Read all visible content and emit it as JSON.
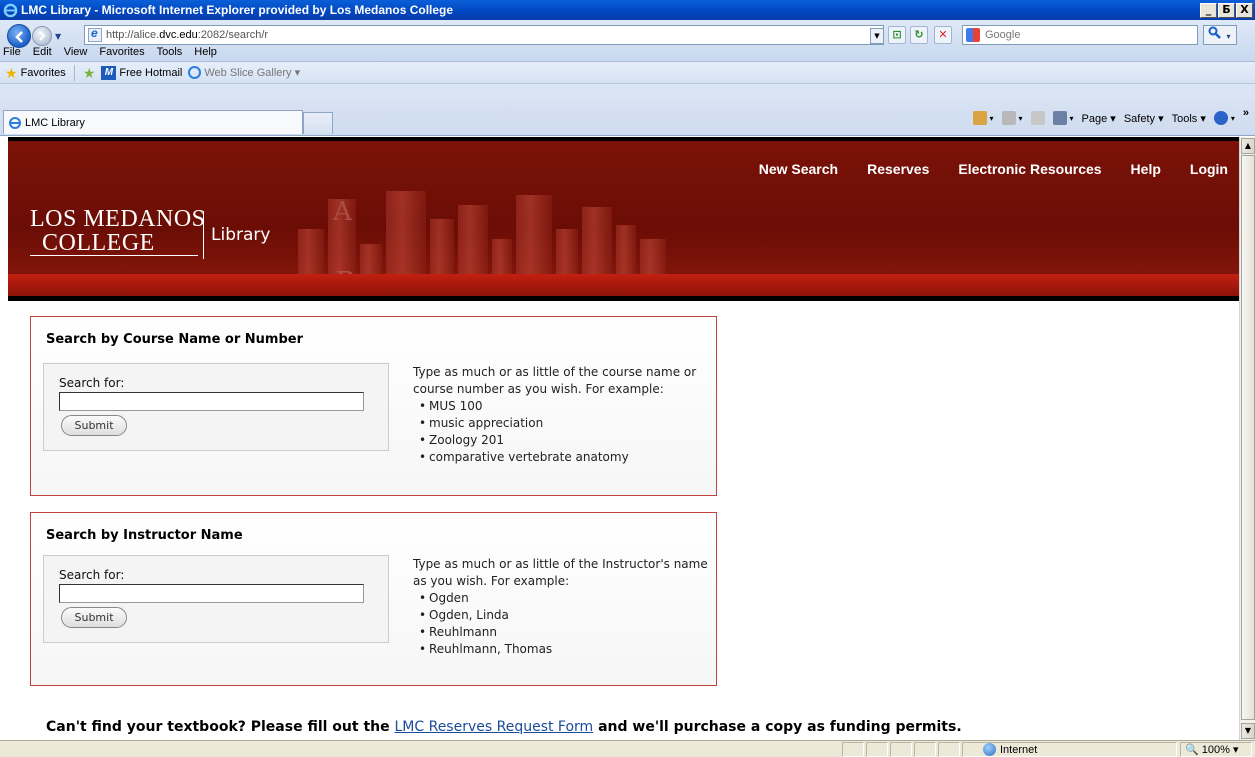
{
  "window": {
    "title": "LMC Library - Microsoft Internet Explorer provided by Los Medanos College",
    "min": "_",
    "max": "Б",
    "close": "X"
  },
  "address": {
    "url_prefix": "http://alice.",
    "url_domain": "dvc.edu",
    "url_suffix": ":2082/search/r",
    "search_placeholder": "Google"
  },
  "menu": [
    "File",
    "Edit",
    "View",
    "Favorites",
    "Tools",
    "Help"
  ],
  "favorites": {
    "label": "Favorites",
    "items": [
      "Free Hotmail",
      "Web Slice Gallery ▾"
    ]
  },
  "tab": {
    "title": "LMC Library"
  },
  "commandbar": {
    "page": "Page ▾",
    "safety": "Safety ▾",
    "tools": "Tools ▾",
    "more": "»"
  },
  "site": {
    "logo_line1": "LOS MEDANOS",
    "logo_line2": "COLLEGE",
    "logo_library": "Library",
    "nav": [
      "New Search",
      "Reserves",
      "Electronic Resources",
      "Help",
      "Login"
    ]
  },
  "course_search": {
    "heading": "Search by Course Name or Number",
    "label": "Search for:",
    "value": "",
    "submit": "Submit",
    "help_text": "Type as much or as little of the course name or course number as you wish. For example:",
    "examples": [
      "MUS 100",
      "music appreciation",
      "Zoology 201",
      "comparative vertebrate anatomy"
    ]
  },
  "instructor_search": {
    "heading": "Search by Instructor Name",
    "label": "Search for:",
    "value": "",
    "submit": "Submit",
    "help_text": "Type as much or as little of the Instructor's name as you wish. For example:",
    "examples": [
      "Ogden",
      "Ogden, Linda",
      "Reuhlmann",
      "Reuhlmann, Thomas"
    ]
  },
  "footer": {
    "before": "Can't find your textbook? Please fill out the",
    "link": "LMC Reserves Request Form",
    "after": "and we'll purchase a copy as funding permits."
  },
  "status": {
    "zone": "Internet",
    "zoom": "🔍 100%  ▾"
  },
  "colors": {
    "banner": "#6b0d05",
    "panel_border": "#c14340",
    "link": "#1b4c9a"
  }
}
